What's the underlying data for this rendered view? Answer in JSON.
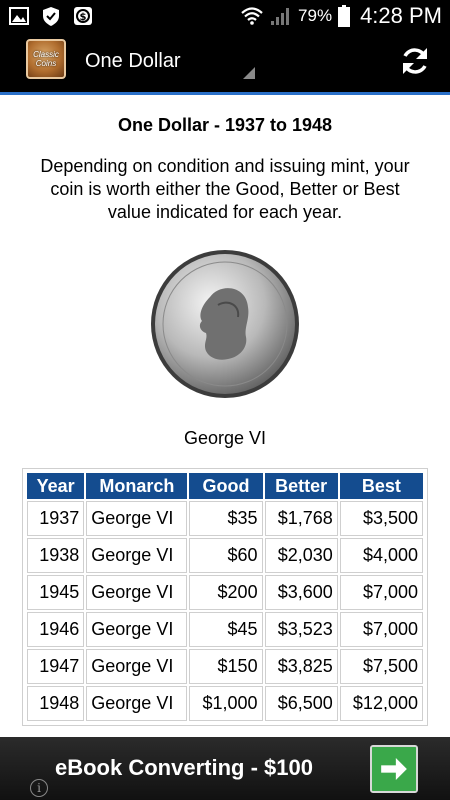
{
  "status_bar": {
    "icons": [
      "image-icon",
      "shield-icon",
      "dollar-app-icon",
      "wifi-icon",
      "signal-icon",
      "battery-icon"
    ],
    "battery_percent": "79%",
    "time": "4:28 PM"
  },
  "action_bar": {
    "logo_line1": "Classic",
    "logo_line2": "Coins",
    "title": "One Dollar",
    "refresh_icon": "refresh-icon"
  },
  "colors": {
    "action_bar_bg": "#000000",
    "divider": "#2a70c8",
    "table_header_bg": "#144c8f",
    "ad_button": "#3aa84a"
  },
  "page": {
    "title": "One Dollar - 1937 to 1948",
    "description": "Depending on condition and issuing mint, your coin is worth either the Good, Better or Best value indicated for each year.",
    "coin_caption": "George VI"
  },
  "table": {
    "headers": [
      "Year",
      "Monarch",
      "Good",
      "Better",
      "Best"
    ],
    "rows": [
      [
        "1937",
        "George VI",
        "$35",
        "$1,768",
        "$3,500"
      ],
      [
        "1938",
        "George VI",
        "$60",
        "$2,030",
        "$4,000"
      ],
      [
        "1945",
        "George VI",
        "$200",
        "$3,600",
        "$7,000"
      ],
      [
        "1946",
        "George VI",
        "$45",
        "$3,523",
        "$7,000"
      ],
      [
        "1947",
        "George VI",
        "$150",
        "$3,825",
        "$7,500"
      ],
      [
        "1948",
        "George VI",
        "$1,000",
        "$6,500",
        "$12,000"
      ]
    ]
  },
  "ad": {
    "text": "eBook Converting - $100",
    "info_glyph": "i",
    "go_icon": "arrow-right-icon"
  }
}
